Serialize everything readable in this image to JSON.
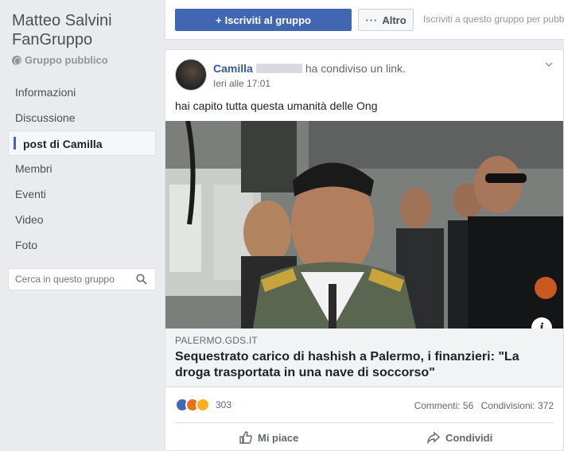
{
  "group": {
    "title": "Matteo Salvini FanGruppo",
    "type": "Gruppo pubblico"
  },
  "sidebar": {
    "items": [
      {
        "label": "Informazioni",
        "active": false
      },
      {
        "label": "Discussione",
        "active": false
      },
      {
        "label": "post di Camilla",
        "active": true
      },
      {
        "label": "Membri",
        "active": false
      },
      {
        "label": "Eventi",
        "active": false
      },
      {
        "label": "Video",
        "active": false
      },
      {
        "label": "Foto",
        "active": false
      }
    ],
    "search_placeholder": "Cerca in questo gruppo"
  },
  "topbar": {
    "join_label": "Iscriviti al gruppo",
    "more_label": "Altro",
    "hint": "Iscriviti a questo gruppo per pubb"
  },
  "post": {
    "author": "Camilla",
    "action": "ha condiviso un link.",
    "time": "Ieri alle 17:01",
    "text": "hai capito tutta questa umanità delle Ong",
    "link": {
      "domain": "PALERMO.GDS.IT",
      "title": "Sequestrato carico di hashish a Palermo, i finanzieri: \"La droga trasportata in una nave di soccorso\""
    },
    "reaction_count": "303",
    "comments": "Commenti: 56",
    "shares": "Condivisioni: 372",
    "like_label": "Mi piace",
    "share_label": "Condividi"
  },
  "colors": {
    "brand": "#4267b2",
    "link": "#385898",
    "background": "#e9ebee"
  },
  "icons": [
    "globe-icon",
    "search-icon",
    "plus-icon",
    "more-dots-icon",
    "chevron-down-icon",
    "info-icon",
    "like-reaction-icon",
    "angry-reaction-icon",
    "wow-reaction-icon",
    "thumbs-up-icon",
    "share-arrow-icon"
  ]
}
